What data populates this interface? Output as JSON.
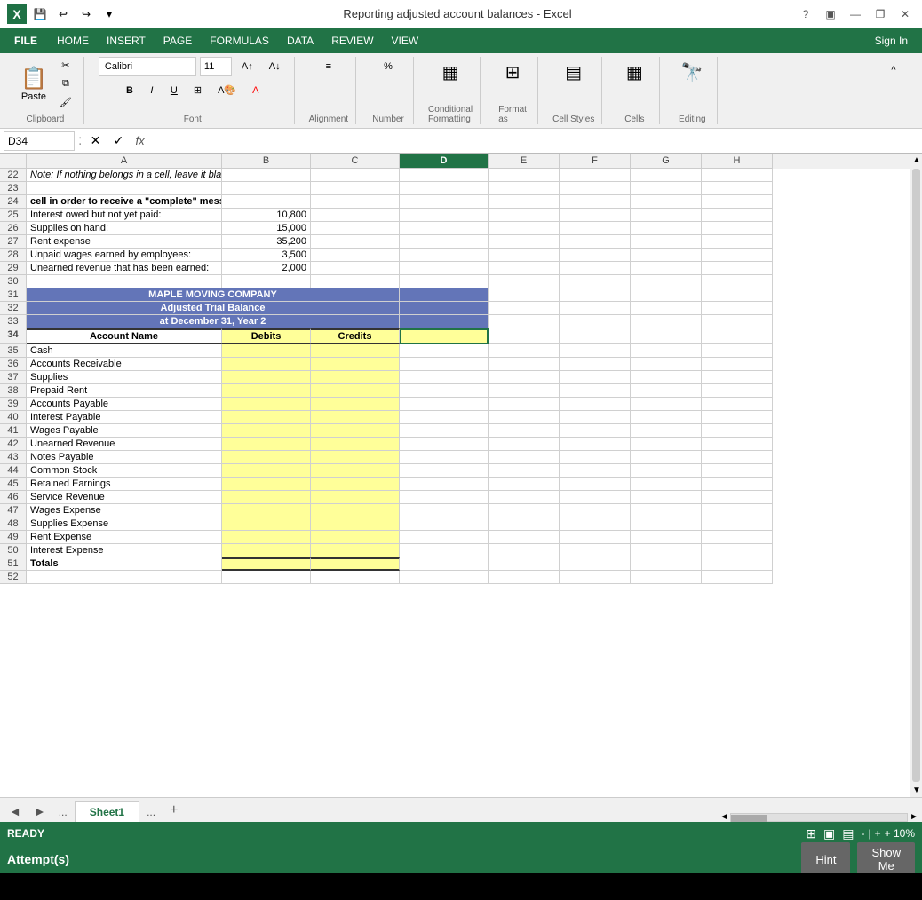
{
  "titleBar": {
    "title": "Reporting adjusted account balances - Excel",
    "helpBtn": "?",
    "windowBtns": [
      "—",
      "❐",
      "✕"
    ]
  },
  "menuBar": {
    "file": "FILE",
    "items": [
      "HOME",
      "INSERT",
      "PAGE",
      "FORMULAS",
      "DATA",
      "REVIEW",
      "VIEW"
    ],
    "signIn": "Sign In"
  },
  "ribbon": {
    "clipboardLabel": "Clipboard",
    "pasteLabel": "Paste",
    "fontLabel": "Font",
    "fontName": "Calibri",
    "fontSize": "11",
    "alignmentLabel": "Alignment",
    "numberLabel": "Number",
    "condFormatLabel": "Conditional Formatting",
    "formatAsLabel": "Format as",
    "cellStylesLabel": "Cell Styles",
    "cellsLabel": "Cells",
    "editingLabel": "Editing"
  },
  "formulaBar": {
    "nameBox": "D34",
    "fx": "fx"
  },
  "columns": [
    "A",
    "B",
    "C",
    "D",
    "E",
    "F",
    "G",
    "H"
  ],
  "rows": [
    {
      "num": 22,
      "a": "Note: If nothing belongs in a cell, leave it blank.",
      "aStyle": "italic-note",
      "b": "",
      "c": "",
      "d": "",
      "e": "",
      "f": "",
      "g": "",
      "h": ""
    },
    {
      "num": 23,
      "a": "",
      "b": "",
      "c": "",
      "d": "",
      "e": "",
      "f": "",
      "g": "",
      "h": ""
    },
    {
      "num": 24,
      "a": "cell in order to receive a \"complete\" message when submitting.",
      "aStyle": "bold-text",
      "b": "",
      "c": "",
      "d": "",
      "e": "",
      "f": "",
      "g": "",
      "h": ""
    },
    {
      "num": 25,
      "a": "Interest owed but not yet paid:",
      "b": "10,800",
      "c": "",
      "d": "",
      "e": "",
      "f": "",
      "g": "",
      "h": ""
    },
    {
      "num": 26,
      "a": "Supplies on hand:",
      "b": "15,000",
      "c": "",
      "d": "",
      "e": "",
      "f": "",
      "g": "",
      "h": ""
    },
    {
      "num": 27,
      "a": "Rent expense",
      "b": "35,200",
      "c": "",
      "d": "",
      "e": "",
      "f": "",
      "g": "",
      "h": ""
    },
    {
      "num": 28,
      "a": "Unpaid wages earned by employees:",
      "b": "3,500",
      "c": "",
      "d": "",
      "e": "",
      "f": "",
      "g": "",
      "h": ""
    },
    {
      "num": 29,
      "a": "Unearned revenue that has been earned:",
      "b": "2,000",
      "c": "",
      "d": "",
      "e": "",
      "f": "",
      "g": "",
      "h": ""
    },
    {
      "num": 30,
      "a": "",
      "b": "",
      "c": "",
      "d": "",
      "e": "",
      "f": "",
      "g": "",
      "h": ""
    },
    {
      "num": 31,
      "a": "MAPLE MOVING COMPANY",
      "aStyle": "blue-header",
      "bStyle": "blue-header",
      "cStyle": "blue-header",
      "dStyle": "blue-header",
      "b": "",
      "c": "",
      "d": "",
      "e": "",
      "f": "",
      "g": "",
      "h": "",
      "merged": true
    },
    {
      "num": 32,
      "a": "Adjusted Trial Balance",
      "aStyle": "blue-header",
      "bStyle": "blue-header",
      "cStyle": "blue-header",
      "dStyle": "blue-header",
      "b": "",
      "c": "",
      "d": "",
      "e": "",
      "f": "",
      "g": "",
      "h": "",
      "merged": true
    },
    {
      "num": 33,
      "a": "at December 31, Year 2",
      "aStyle": "blue-header",
      "bStyle": "blue-header",
      "cStyle": "blue-header",
      "dStyle": "blue-header",
      "b": "",
      "c": "",
      "d": "",
      "e": "",
      "f": "",
      "g": "",
      "h": "",
      "merged": true
    },
    {
      "num": 34,
      "a": "Account Name",
      "aStyle": "header-row bold-text",
      "b": "Debits",
      "bStyle": "header-row bold-text yellow",
      "c": "Credits",
      "cStyle": "header-row bold-text yellow",
      "d": "",
      "dStyle": "yellow selected-cell",
      "e": "",
      "f": "",
      "g": "",
      "h": ""
    },
    {
      "num": 35,
      "a": "Cash",
      "b": "",
      "bStyle": "yellow",
      "c": "",
      "cStyle": "yellow",
      "d": "",
      "e": "",
      "f": "",
      "g": "",
      "h": ""
    },
    {
      "num": 36,
      "a": "Accounts Receivable",
      "b": "",
      "bStyle": "yellow",
      "c": "",
      "cStyle": "yellow",
      "d": "",
      "e": "",
      "f": "",
      "g": "",
      "h": ""
    },
    {
      "num": 37,
      "a": "Supplies",
      "b": "",
      "bStyle": "yellow",
      "c": "",
      "cStyle": "yellow",
      "d": "",
      "e": "",
      "f": "",
      "g": "",
      "h": ""
    },
    {
      "num": 38,
      "a": "Prepaid Rent",
      "b": "",
      "bStyle": "yellow",
      "c": "",
      "cStyle": "yellow",
      "d": "",
      "e": "",
      "f": "",
      "g": "",
      "h": ""
    },
    {
      "num": 39,
      "a": "Accounts Payable",
      "b": "",
      "bStyle": "yellow",
      "c": "",
      "cStyle": "yellow",
      "d": "",
      "e": "",
      "f": "",
      "g": "",
      "h": ""
    },
    {
      "num": 40,
      "a": "Interest Payable",
      "b": "",
      "bStyle": "yellow",
      "c": "",
      "cStyle": "yellow",
      "d": "",
      "e": "",
      "f": "",
      "g": "",
      "h": ""
    },
    {
      "num": 41,
      "a": "Wages Payable",
      "b": "",
      "bStyle": "yellow",
      "c": "",
      "cStyle": "yellow",
      "d": "",
      "e": "",
      "f": "",
      "g": "",
      "h": ""
    },
    {
      "num": 42,
      "a": "Unearned Revenue",
      "b": "",
      "bStyle": "yellow",
      "c": "",
      "cStyle": "yellow",
      "d": "",
      "e": "",
      "f": "",
      "g": "",
      "h": ""
    },
    {
      "num": 43,
      "a": "Notes Payable",
      "b": "",
      "bStyle": "yellow",
      "c": "",
      "cStyle": "yellow",
      "d": "",
      "e": "",
      "f": "",
      "g": "",
      "h": ""
    },
    {
      "num": 44,
      "a": "Common Stock",
      "b": "",
      "bStyle": "yellow",
      "c": "",
      "cStyle": "yellow",
      "d": "",
      "e": "",
      "f": "",
      "g": "",
      "h": ""
    },
    {
      "num": 45,
      "a": "Retained Earnings",
      "b": "",
      "bStyle": "yellow",
      "c": "",
      "cStyle": "yellow",
      "d": "",
      "e": "",
      "f": "",
      "g": "",
      "h": ""
    },
    {
      "num": 46,
      "a": "Service Revenue",
      "b": "",
      "bStyle": "yellow",
      "c": "",
      "cStyle": "yellow",
      "d": "",
      "e": "",
      "f": "",
      "g": "",
      "h": ""
    },
    {
      "num": 47,
      "a": "Wages Expense",
      "b": "",
      "bStyle": "yellow",
      "c": "",
      "cStyle": "yellow",
      "d": "",
      "e": "",
      "f": "",
      "g": "",
      "h": ""
    },
    {
      "num": 48,
      "a": "Supplies Expense",
      "b": "",
      "bStyle": "yellow",
      "c": "",
      "cStyle": "yellow",
      "d": "",
      "e": "",
      "f": "",
      "g": "",
      "h": ""
    },
    {
      "num": 49,
      "a": "Rent Expense",
      "b": "",
      "bStyle": "yellow",
      "c": "",
      "cStyle": "yellow",
      "d": "",
      "e": "",
      "f": "",
      "g": "",
      "h": ""
    },
    {
      "num": 50,
      "a": "Interest Expense",
      "b": "",
      "bStyle": "yellow",
      "c": "",
      "cStyle": "yellow",
      "d": "",
      "e": "",
      "f": "",
      "g": "",
      "h": ""
    },
    {
      "num": 51,
      "a": "Totals",
      "aStyle": "bold-text",
      "b": "",
      "bStyle": "yellow",
      "c": "",
      "cStyle": "yellow",
      "d": "",
      "e": "",
      "f": "",
      "g": "",
      "h": ""
    },
    {
      "num": 52,
      "a": "",
      "b": "",
      "c": "",
      "d": "",
      "e": "",
      "f": "",
      "g": "",
      "h": ""
    }
  ],
  "sheetTabs": {
    "prevBtn": "◄",
    "nextBtn": "►",
    "dots": "...",
    "activeTab": "Sheet1",
    "addBtn": "+"
  },
  "statusBar": {
    "status": "READY",
    "zoom": "10%",
    "zoomLabel": "+ 10%",
    "viewBtns": [
      "⊞",
      "▣",
      "▤"
    ]
  },
  "bottomBar": {
    "attempts": "Attempt(s)",
    "hintBtn": "Hint",
    "showBtn": "Show\nMe"
  }
}
